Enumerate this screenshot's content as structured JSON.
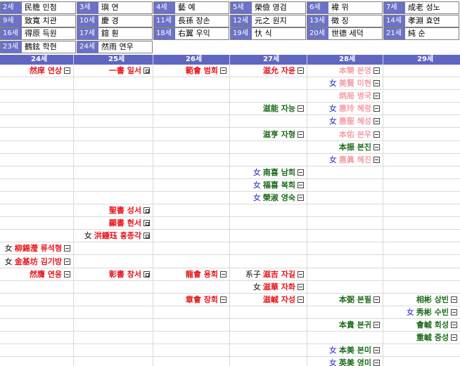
{
  "generations": [
    {
      "gen": "2세",
      "name": "民贍 민첨"
    },
    {
      "gen": "3세",
      "name": "璵 연"
    },
    {
      "gen": "4세",
      "name": "藝 예"
    },
    {
      "gen": "5세",
      "name": "榮儉 영검"
    },
    {
      "gen": "6세",
      "name": "褘 위"
    },
    {
      "gen": "7세",
      "name": "成老 성노"
    },
    {
      "gen": "9세",
      "name": "致寬 치관"
    },
    {
      "gen": "10세",
      "name": "慶 경"
    },
    {
      "gen": "11세",
      "name": "長孫 장손"
    },
    {
      "gen": "12세",
      "name": "元之 원지"
    },
    {
      "gen": "13세",
      "name": "徵 징"
    },
    {
      "gen": "14세",
      "name": "孝淵 효연"
    },
    {
      "gen": "16세",
      "name": "得原 득원"
    },
    {
      "gen": "17세",
      "name": "鍹 훤"
    },
    {
      "gen": "18세",
      "name": "右翼 우익"
    },
    {
      "gen": "19세",
      "name": "忕 식"
    },
    {
      "gen": "20세",
      "name": "世德 세덕"
    },
    {
      "gen": "21세",
      "name": "純 순"
    },
    {
      "gen": "23세",
      "name": "鶴鉉 학현"
    },
    {
      "gen": "24세",
      "name": "然雨 연우"
    }
  ],
  "columns": [
    "24세",
    "25세",
    "26세",
    "27세",
    "28세",
    "29세"
  ],
  "rows": [
    [
      {
        "col": 0,
        "text": "然庠 연상",
        "color": "red",
        "icon": "minus"
      },
      {
        "col": 1,
        "text": "一書 일서",
        "color": "red",
        "icon": "box"
      },
      {
        "col": 2,
        "text": "範會 범회",
        "color": "red",
        "icon": "minus"
      },
      {
        "col": 3,
        "text": "滋允 자윤",
        "color": "red",
        "icon": "minus"
      },
      {
        "col": 4,
        "text": "本榮 본영",
        "color": "pink",
        "icon": "minus"
      }
    ],
    [
      {
        "col": 4,
        "prefix": "女",
        "text": "美賢 미현",
        "color": "pink",
        "icon": "minus"
      }
    ],
    [
      {
        "col": 4,
        "text": "炳局 병국",
        "color": "pink",
        "icon": "minus"
      }
    ],
    [
      {
        "col": 3,
        "text": "滋能 자능",
        "color": "green",
        "icon": "minus"
      },
      {
        "col": 4,
        "prefix": "女",
        "text": "惠玲 혜령",
        "color": "pink",
        "icon": "minus"
      }
    ],
    [
      {
        "col": 4,
        "prefix": "女",
        "text": "惠聖 혜성",
        "color": "pink",
        "icon": "minus"
      }
    ],
    [
      {
        "col": 3,
        "text": "滋亨 자형",
        "color": "green",
        "icon": "minus"
      },
      {
        "col": 4,
        "text": "本佑 본우",
        "color": "pink",
        "icon": "minus"
      }
    ],
    [
      {
        "col": 4,
        "text": "本振 본진",
        "color": "green",
        "icon": "minus"
      }
    ],
    [
      {
        "col": 4,
        "prefix": "女",
        "text": "惠眞 혜진",
        "color": "pink",
        "icon": "minus"
      }
    ],
    [
      {
        "col": 3,
        "prefix": "女",
        "text": "南喜 남희",
        "color": "green",
        "icon": "minus"
      }
    ],
    [
      {
        "col": 3,
        "prefix": "女",
        "text": "福喜 복희",
        "color": "green",
        "icon": "minus"
      }
    ],
    [
      {
        "col": 3,
        "prefix": "女",
        "text": "榮淑 영숙",
        "color": "green",
        "icon": "minus"
      }
    ],
    [
      {
        "col": 1,
        "text": "聖書 성서",
        "color": "red",
        "icon": "box"
      }
    ],
    [
      {
        "col": 1,
        "text": "顯書 현서",
        "color": "red",
        "icon": "box"
      }
    ],
    [
      {
        "col": 1,
        "prefix": "女",
        "prefixStyle": "blk",
        "text": "洪鍾珏 홍종각",
        "color": "red",
        "icon": "box"
      }
    ],
    [
      {
        "col": 0,
        "prefix": "女",
        "prefixStyle": "blk",
        "text": "柳錫瀅 류석형",
        "color": "red",
        "icon": "minus"
      }
    ],
    [
      {
        "col": 0,
        "prefix": "女",
        "prefixStyle": "blk",
        "text": "金基坊 김기방",
        "color": "red",
        "icon": "minus"
      }
    ],
    [
      {
        "col": 0,
        "text": "然膺 연응",
        "color": "red",
        "icon": "minus"
      },
      {
        "col": 1,
        "text": "彰書 창서",
        "color": "red",
        "icon": "box"
      },
      {
        "col": 2,
        "text": "龍會 용회",
        "color": "red",
        "icon": "minus"
      },
      {
        "col": 3,
        "prefix": "系子",
        "prefixStyle": "blk",
        "text": "滋吉 자길",
        "color": "red",
        "icon": "minus"
      }
    ],
    [
      {
        "col": 3,
        "prefix": "女",
        "prefixStyle": "blk",
        "text": "滋華 자화",
        "color": "red",
        "icon": "minus"
      }
    ],
    [
      {
        "col": 2,
        "text": "章會 장회",
        "color": "red",
        "icon": "minus"
      },
      {
        "col": 3,
        "text": "滋峸 자성",
        "color": "red",
        "icon": "minus"
      },
      {
        "col": 4,
        "text": "本弼 본필",
        "color": "green",
        "icon": "minus"
      },
      {
        "col": 5,
        "text": "相彬 상빈",
        "color": "green",
        "icon": "minus"
      }
    ],
    [
      {
        "col": 5,
        "prefix": "女",
        "text": "秀彬 수빈",
        "color": "green",
        "icon": "minus"
      }
    ],
    [
      {
        "col": 4,
        "text": "本貴 본귀",
        "color": "green",
        "icon": "minus"
      },
      {
        "col": 5,
        "text": "會峸 회성",
        "color": "green",
        "icon": "minus"
      }
    ],
    [
      {
        "col": 5,
        "text": "重峸 중성",
        "color": "green",
        "icon": "minus"
      }
    ],
    [
      {
        "col": 4,
        "prefix": "女",
        "text": "本美 본미",
        "color": "green",
        "icon": "minus"
      }
    ],
    [
      {
        "col": 4,
        "prefix": "女",
        "text": "英美 영미",
        "color": "green",
        "icon": "minus"
      }
    ]
  ]
}
